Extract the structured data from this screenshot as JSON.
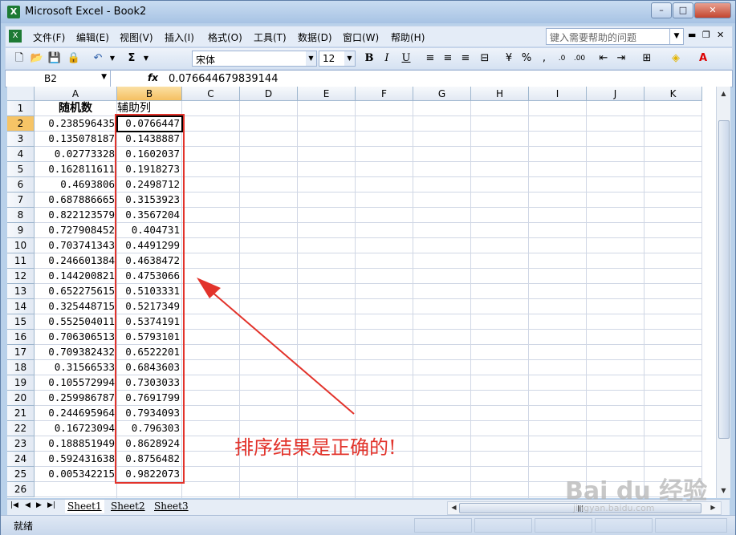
{
  "window": {
    "title": "Microsoft Excel - Book2",
    "app_icon": "excel-icon"
  },
  "menu": {
    "items": [
      "文件(F)",
      "编辑(E)",
      "视图(V)",
      "插入(I)",
      "格式(O)",
      "工具(T)",
      "数据(D)",
      "窗口(W)",
      "帮助(H)"
    ],
    "help_placeholder": "键入需要帮助的问题"
  },
  "toolbar": {
    "font_name": "宋体",
    "font_size": "12",
    "bold": "B",
    "italic": "I",
    "underline": "U",
    "autosum": "Σ",
    "percent": "%"
  },
  "formula_bar": {
    "name_box": "B2",
    "fx": "fx",
    "value": "0.076644679839144"
  },
  "columns": [
    "A",
    "B",
    "C",
    "D",
    "E",
    "F",
    "G",
    "H",
    "I",
    "J",
    "K"
  ],
  "selected_column": "B",
  "selected_row": "2",
  "header_row": {
    "a": "随机数",
    "b": "辅助列"
  },
  "rows": [
    {
      "n": "2",
      "a": "0.238596435",
      "b": "0.0766447"
    },
    {
      "n": "3",
      "a": "0.135078187",
      "b": "0.1438887"
    },
    {
      "n": "4",
      "a": "0.02773328",
      "b": "0.1602037"
    },
    {
      "n": "5",
      "a": "0.162811611",
      "b": "0.1918273"
    },
    {
      "n": "6",
      "a": "0.4693806",
      "b": "0.2498712"
    },
    {
      "n": "7",
      "a": "0.687886665",
      "b": "0.3153923"
    },
    {
      "n": "8",
      "a": "0.822123579",
      "b": "0.3567204"
    },
    {
      "n": "9",
      "a": "0.727908452",
      "b": "0.404731"
    },
    {
      "n": "10",
      "a": "0.703741343",
      "b": "0.4491299"
    },
    {
      "n": "11",
      "a": "0.246601384",
      "b": "0.4638472"
    },
    {
      "n": "12",
      "a": "0.144200821",
      "b": "0.4753066"
    },
    {
      "n": "13",
      "a": "0.652275615",
      "b": "0.5103331"
    },
    {
      "n": "14",
      "a": "0.325448715",
      "b": "0.5217349"
    },
    {
      "n": "15",
      "a": "0.552504011",
      "b": "0.5374191"
    },
    {
      "n": "16",
      "a": "0.706306513",
      "b": "0.5793101"
    },
    {
      "n": "17",
      "a": "0.709382432",
      "b": "0.6522201"
    },
    {
      "n": "18",
      "a": "0.31566533",
      "b": "0.6843603"
    },
    {
      "n": "19",
      "a": "0.105572994",
      "b": "0.7303033"
    },
    {
      "n": "20",
      "a": "0.259986787",
      "b": "0.7691799"
    },
    {
      "n": "21",
      "a": "0.244695964",
      "b": "0.7934093"
    },
    {
      "n": "22",
      "a": "0.16723094",
      "b": "0.796303"
    },
    {
      "n": "23",
      "a": "0.188851949",
      "b": "0.8628924"
    },
    {
      "n": "24",
      "a": "0.592431638",
      "b": "0.8756482"
    },
    {
      "n": "25",
      "a": "0.005342215",
      "b": "0.9822073"
    },
    {
      "n": "26",
      "a": "",
      "b": ""
    }
  ],
  "annotation": {
    "text": "排序结果是正确的!",
    "color": "#e2332b"
  },
  "sheet_tabs": [
    "Sheet1",
    "Sheet2",
    "Sheet3"
  ],
  "active_sheet": "Sheet1",
  "status": {
    "text": "就绪"
  },
  "watermark": {
    "main": "Bai du 经验",
    "sub": "jingyan.baidu.com"
  }
}
